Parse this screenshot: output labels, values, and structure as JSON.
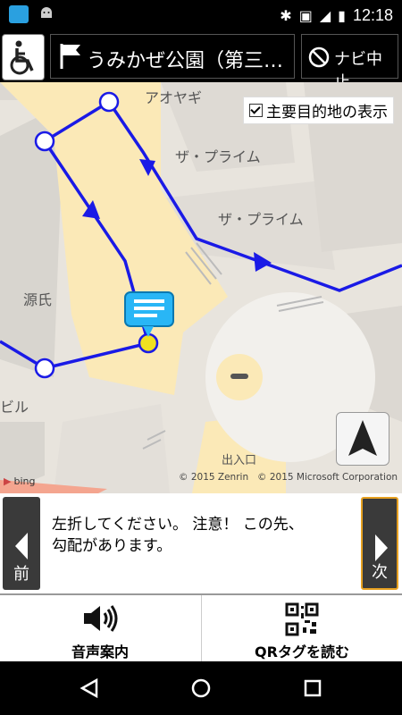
{
  "status_bar": {
    "time": "12:18"
  },
  "header": {
    "title": "うみかぜ公園（第三…",
    "stop_label": "ナビ中止"
  },
  "map": {
    "checkbox_label": "主要目的地の表示",
    "checkbox_checked": true,
    "labels": [
      "アオヤギ",
      "ザ・プライム",
      "ザ・プライム",
      "源氏",
      "ビル",
      "出入口"
    ],
    "copyright_1": "© 2015 Zenrin",
    "copyright_2": "© 2015 Microsoft Corporation",
    "bing_label": "bing",
    "route_color": "#1a1ae6",
    "highlight_color": "#fbe9b7"
  },
  "guidance": {
    "prev_label": "前",
    "next_label": "次",
    "text_line1": "左折してください。 注意！ この先、",
    "text_line2": "勾配があります。"
  },
  "actions": {
    "voice_label": "音声案内",
    "qr_label": "QRタグを読む"
  }
}
